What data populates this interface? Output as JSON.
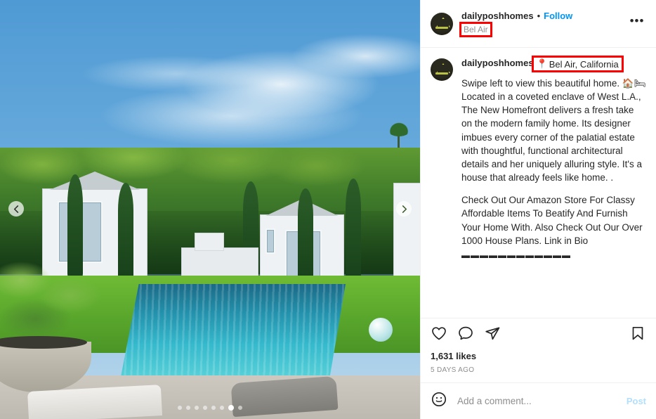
{
  "header": {
    "username": "dailyposhhomes",
    "separator": "•",
    "follow_label": "Follow",
    "sub_location": "Bel Air",
    "more_icon": "ellipsis-icon",
    "avatar_name": "profile-avatar"
  },
  "caption": {
    "username": "dailyposhhomes",
    "location_pin": "📍",
    "location_label": "Bel Air, California",
    "paragraph1": "Swipe left to view this beautiful home. 🏠🛏Located in a coveted enclave of West L.A., The New Homefront delivers a fresh take on the modern family home. Its designer imbues every corner of the palatial estate with thoughtful, functional architectural details and her uniquely alluring style. It's a house that already feels like home. .",
    "paragraph2": "Check Out Our Amazon Store For Classy Affordable Items To Beatify And Furnish Your Home With. Also Check Out Our Over 1000 House Plans. Link in Bio",
    "divider_row": "▬▬▬▬▬▬▬▬▬▬▬▬"
  },
  "actions": {
    "like_icon": "heart-icon",
    "comment_icon": "comment-icon",
    "share_icon": "share-icon",
    "save_icon": "bookmark-icon",
    "likes_text": "1,631 likes",
    "timestamp": "5 DAYS AGO"
  },
  "comment_bar": {
    "emoji_icon": "emoji-smiley-icon",
    "placeholder": "Add a comment...",
    "post_label": "Post"
  },
  "media": {
    "prev_icon": "chevron-left-icon",
    "next_icon": "chevron-right-icon",
    "dots_count": 8,
    "active_dot_index": 6,
    "alt": "luxury backyard with swimming pool and white pool houses"
  },
  "colors": {
    "accent_blue": "#0095f6",
    "post_blue": "#b2dffc",
    "annotation_red": "#ff0000",
    "text_primary": "#262626",
    "text_secondary": "#8e8e8e"
  }
}
